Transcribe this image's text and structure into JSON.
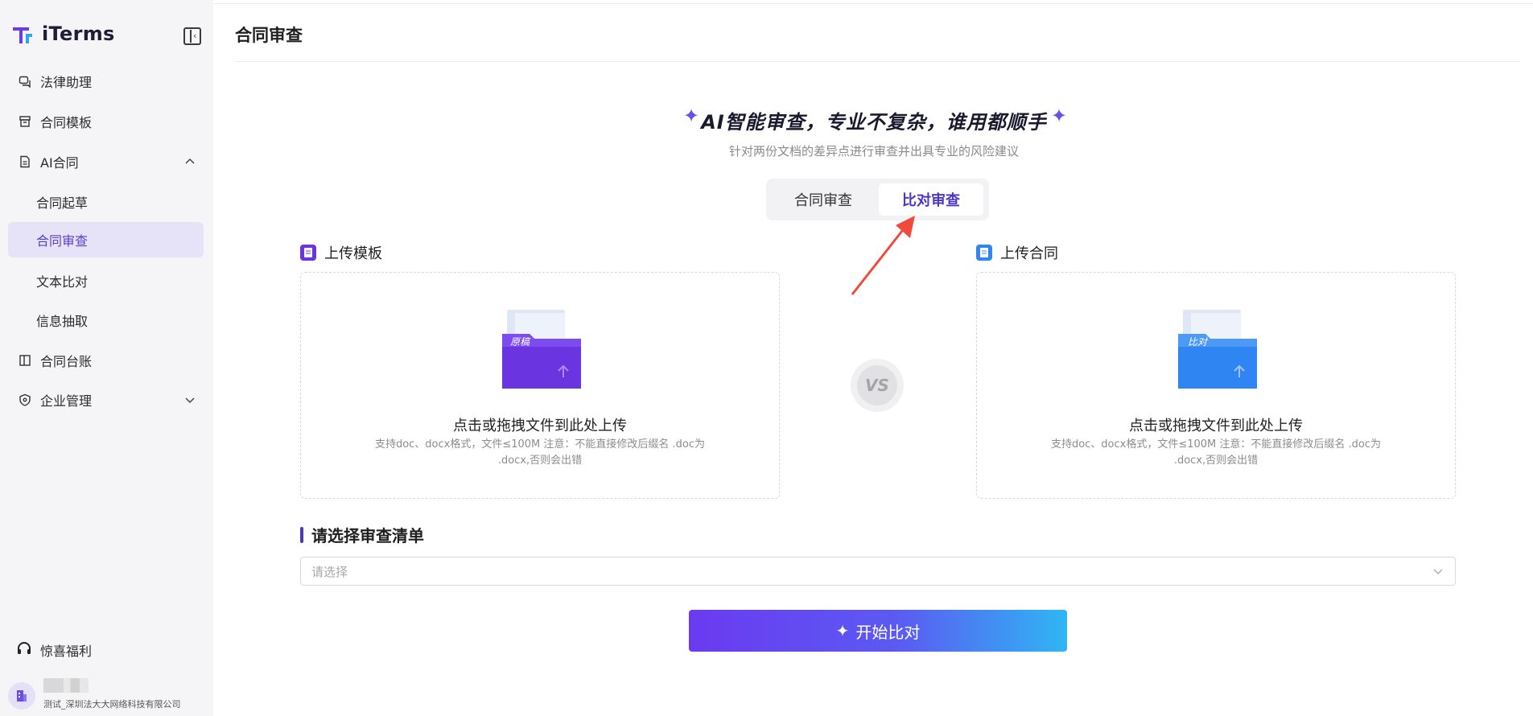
{
  "app": {
    "name": "iTerms"
  },
  "sidebar": {
    "items": [
      {
        "label": "法律助理",
        "icon": "chat-icon"
      },
      {
        "label": "合同模板",
        "icon": "archive-icon"
      },
      {
        "label": "AI合同",
        "icon": "document-icon",
        "expanded": true
      },
      {
        "label": "合同起草"
      },
      {
        "label": "合同审查",
        "active": true
      },
      {
        "label": "文本比对"
      },
      {
        "label": "信息抽取"
      },
      {
        "label": "合同台账",
        "icon": "ledger-icon"
      },
      {
        "label": "企业管理",
        "icon": "shield-icon",
        "expanded": false
      }
    ],
    "welfare_label": "惊喜福利",
    "company": "测试_深圳法大大网络科技有限公司"
  },
  "page": {
    "title": "合同审查"
  },
  "hero": {
    "title": "AI智能审查，专业不复杂，谁用都顺手",
    "subtitle": "针对两份文档的差异点进行审查并出具专业的风险建议"
  },
  "tabs": [
    {
      "label": "合同审查",
      "active": false
    },
    {
      "label": "比对审查",
      "active": true
    }
  ],
  "upload_left": {
    "label": "上传模板",
    "folder_tag": "原稿",
    "main_text": "点击或拖拽文件到此处上传",
    "hint": "支持doc、docx格式，文件≤100M 注意：不能直接修改后缀名 .doc为 .docx,否则会出错"
  },
  "upload_right": {
    "label": "上传合同",
    "folder_tag": "比对",
    "main_text": "点击或拖拽文件到此处上传",
    "hint": "支持doc、docx格式，文件≤100M 注意：不能直接修改后缀名 .doc为 .docx,否则会出错"
  },
  "vs_label": "VS",
  "checklist": {
    "title": "请选择审查清单",
    "placeholder": "请选择"
  },
  "start_button": {
    "label": "开始比对"
  },
  "colors": {
    "accent": "#5b3ec9",
    "sidebar_bg": "#f5f5f7",
    "left_folder": "#6a35e0",
    "right_folder": "#2f86f2"
  }
}
